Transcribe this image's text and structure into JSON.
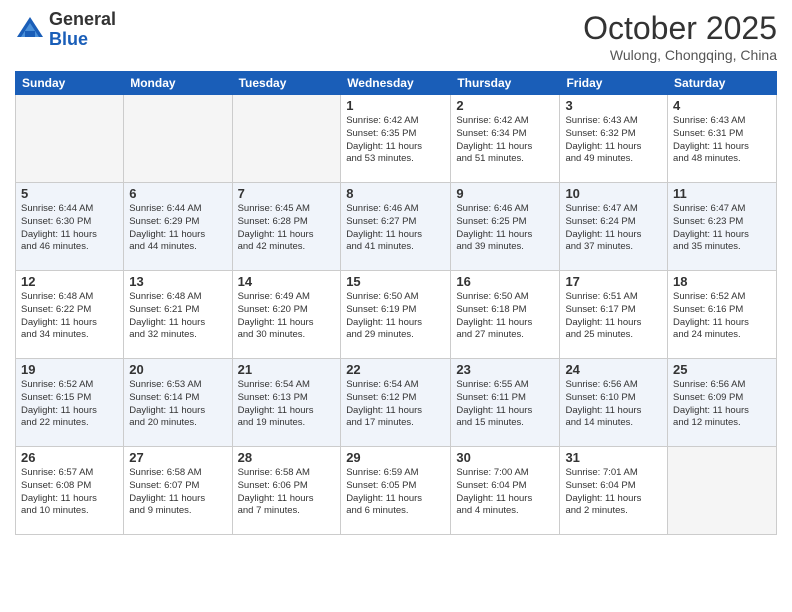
{
  "logo": {
    "general": "General",
    "blue": "Blue"
  },
  "title": "October 2025",
  "location": "Wulong, Chongqing, China",
  "days_header": [
    "Sunday",
    "Monday",
    "Tuesday",
    "Wednesday",
    "Thursday",
    "Friday",
    "Saturday"
  ],
  "weeks": [
    [
      {
        "num": "",
        "info": ""
      },
      {
        "num": "",
        "info": ""
      },
      {
        "num": "",
        "info": ""
      },
      {
        "num": "1",
        "info": "Sunrise: 6:42 AM\nSunset: 6:35 PM\nDaylight: 11 hours\nand 53 minutes."
      },
      {
        "num": "2",
        "info": "Sunrise: 6:42 AM\nSunset: 6:34 PM\nDaylight: 11 hours\nand 51 minutes."
      },
      {
        "num": "3",
        "info": "Sunrise: 6:43 AM\nSunset: 6:32 PM\nDaylight: 11 hours\nand 49 minutes."
      },
      {
        "num": "4",
        "info": "Sunrise: 6:43 AM\nSunset: 6:31 PM\nDaylight: 11 hours\nand 48 minutes."
      }
    ],
    [
      {
        "num": "5",
        "info": "Sunrise: 6:44 AM\nSunset: 6:30 PM\nDaylight: 11 hours\nand 46 minutes."
      },
      {
        "num": "6",
        "info": "Sunrise: 6:44 AM\nSunset: 6:29 PM\nDaylight: 11 hours\nand 44 minutes."
      },
      {
        "num": "7",
        "info": "Sunrise: 6:45 AM\nSunset: 6:28 PM\nDaylight: 11 hours\nand 42 minutes."
      },
      {
        "num": "8",
        "info": "Sunrise: 6:46 AM\nSunset: 6:27 PM\nDaylight: 11 hours\nand 41 minutes."
      },
      {
        "num": "9",
        "info": "Sunrise: 6:46 AM\nSunset: 6:25 PM\nDaylight: 11 hours\nand 39 minutes."
      },
      {
        "num": "10",
        "info": "Sunrise: 6:47 AM\nSunset: 6:24 PM\nDaylight: 11 hours\nand 37 minutes."
      },
      {
        "num": "11",
        "info": "Sunrise: 6:47 AM\nSunset: 6:23 PM\nDaylight: 11 hours\nand 35 minutes."
      }
    ],
    [
      {
        "num": "12",
        "info": "Sunrise: 6:48 AM\nSunset: 6:22 PM\nDaylight: 11 hours\nand 34 minutes."
      },
      {
        "num": "13",
        "info": "Sunrise: 6:48 AM\nSunset: 6:21 PM\nDaylight: 11 hours\nand 32 minutes."
      },
      {
        "num": "14",
        "info": "Sunrise: 6:49 AM\nSunset: 6:20 PM\nDaylight: 11 hours\nand 30 minutes."
      },
      {
        "num": "15",
        "info": "Sunrise: 6:50 AM\nSunset: 6:19 PM\nDaylight: 11 hours\nand 29 minutes."
      },
      {
        "num": "16",
        "info": "Sunrise: 6:50 AM\nSunset: 6:18 PM\nDaylight: 11 hours\nand 27 minutes."
      },
      {
        "num": "17",
        "info": "Sunrise: 6:51 AM\nSunset: 6:17 PM\nDaylight: 11 hours\nand 25 minutes."
      },
      {
        "num": "18",
        "info": "Sunrise: 6:52 AM\nSunset: 6:16 PM\nDaylight: 11 hours\nand 24 minutes."
      }
    ],
    [
      {
        "num": "19",
        "info": "Sunrise: 6:52 AM\nSunset: 6:15 PM\nDaylight: 11 hours\nand 22 minutes."
      },
      {
        "num": "20",
        "info": "Sunrise: 6:53 AM\nSunset: 6:14 PM\nDaylight: 11 hours\nand 20 minutes."
      },
      {
        "num": "21",
        "info": "Sunrise: 6:54 AM\nSunset: 6:13 PM\nDaylight: 11 hours\nand 19 minutes."
      },
      {
        "num": "22",
        "info": "Sunrise: 6:54 AM\nSunset: 6:12 PM\nDaylight: 11 hours\nand 17 minutes."
      },
      {
        "num": "23",
        "info": "Sunrise: 6:55 AM\nSunset: 6:11 PM\nDaylight: 11 hours\nand 15 minutes."
      },
      {
        "num": "24",
        "info": "Sunrise: 6:56 AM\nSunset: 6:10 PM\nDaylight: 11 hours\nand 14 minutes."
      },
      {
        "num": "25",
        "info": "Sunrise: 6:56 AM\nSunset: 6:09 PM\nDaylight: 11 hours\nand 12 minutes."
      }
    ],
    [
      {
        "num": "26",
        "info": "Sunrise: 6:57 AM\nSunset: 6:08 PM\nDaylight: 11 hours\nand 10 minutes."
      },
      {
        "num": "27",
        "info": "Sunrise: 6:58 AM\nSunset: 6:07 PM\nDaylight: 11 hours\nand 9 minutes."
      },
      {
        "num": "28",
        "info": "Sunrise: 6:58 AM\nSunset: 6:06 PM\nDaylight: 11 hours\nand 7 minutes."
      },
      {
        "num": "29",
        "info": "Sunrise: 6:59 AM\nSunset: 6:05 PM\nDaylight: 11 hours\nand 6 minutes."
      },
      {
        "num": "30",
        "info": "Sunrise: 7:00 AM\nSunset: 6:04 PM\nDaylight: 11 hours\nand 4 minutes."
      },
      {
        "num": "31",
        "info": "Sunrise: 7:01 AM\nSunset: 6:04 PM\nDaylight: 11 hours\nand 2 minutes."
      },
      {
        "num": "",
        "info": ""
      }
    ]
  ]
}
